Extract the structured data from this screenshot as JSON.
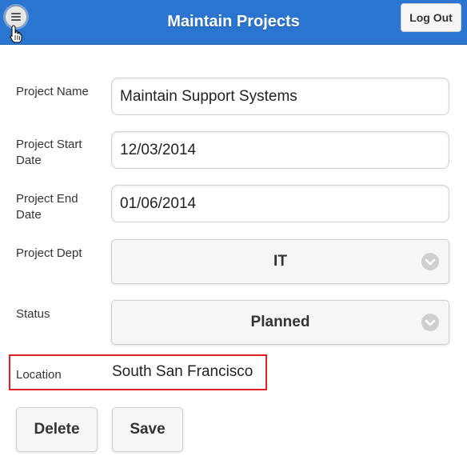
{
  "header": {
    "title": "Maintain Projects",
    "logout_label": "Log Out",
    "menu_icon": "hamburger-menu-icon",
    "accent_color": "#2a75cf"
  },
  "form": {
    "project_name": {
      "label": "Project Name",
      "value": "Maintain Support Systems"
    },
    "start_date": {
      "label": "Project Start Date",
      "value": "12/03/2014"
    },
    "end_date": {
      "label": "Project End Date",
      "value": "01/06/2014"
    },
    "dept": {
      "label": "Project Dept",
      "selected": "IT"
    },
    "status": {
      "label": "Status",
      "selected": "Planned"
    },
    "location": {
      "label": "Location",
      "value": "South San Francisco"
    }
  },
  "actions": {
    "delete_label": "Delete",
    "save_label": "Save"
  },
  "highlight_color": "#e02020"
}
